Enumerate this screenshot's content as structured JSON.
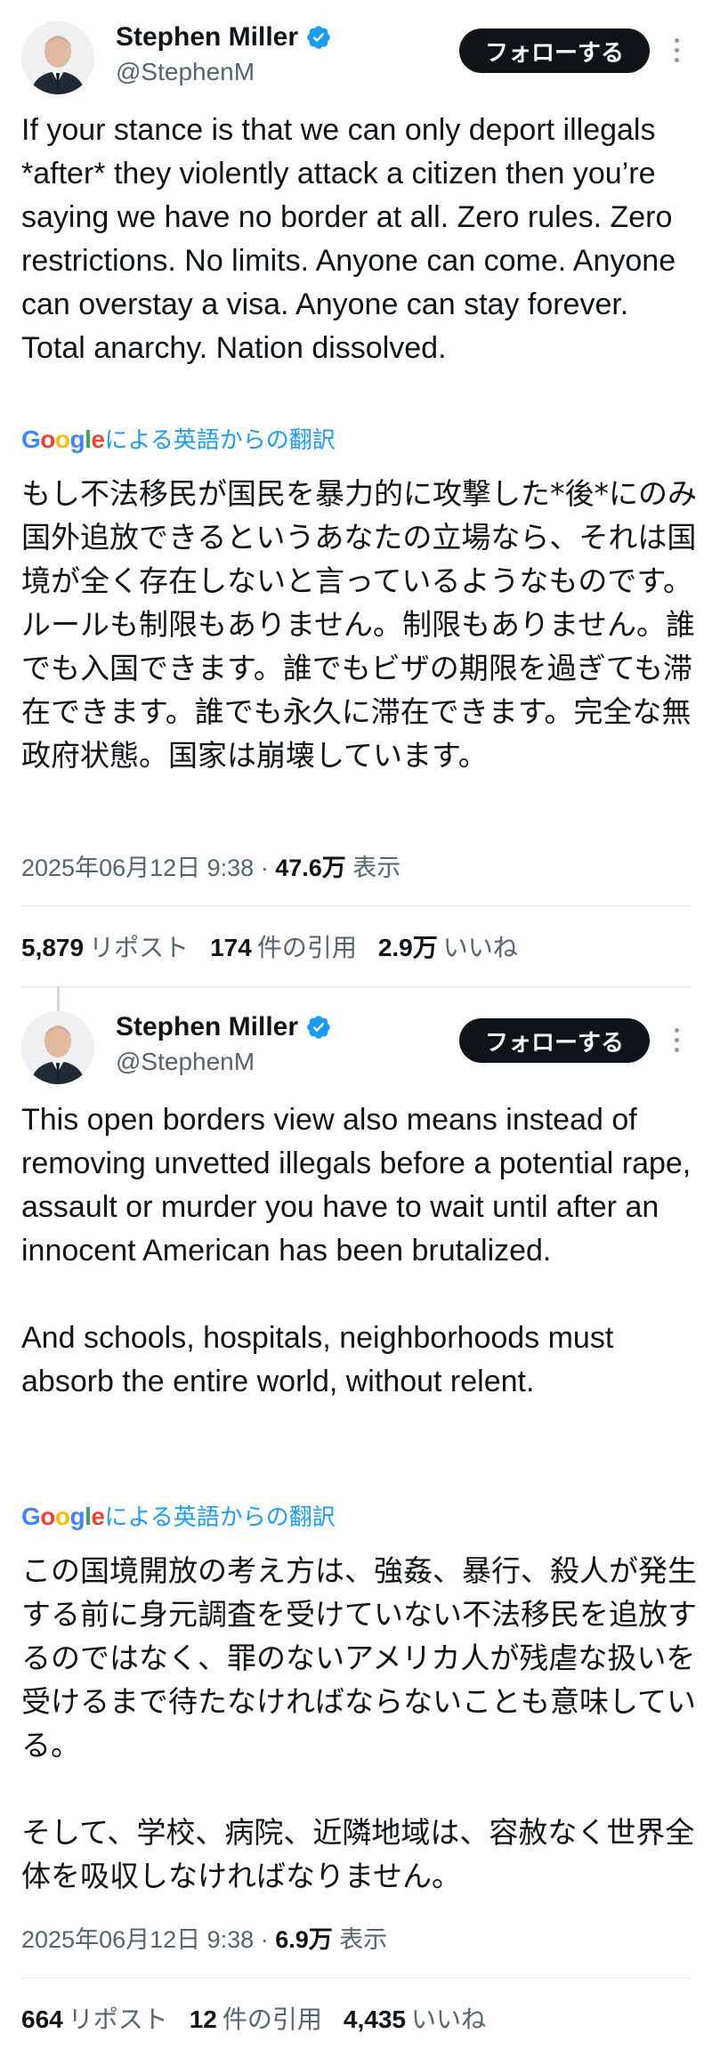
{
  "tweets": [
    {
      "author": "Stephen Miller",
      "handle": "@StephenM",
      "follow_label": "フォローする",
      "text": "If your stance is that we can only deport illegals *after* they violently attack a citizen then you’re saying we have no border at all. Zero rules. Zero restrictions. No limits. Anyone can come. Anyone can overstay a visa. Anyone can stay forever. Total anarchy. Nation dissolved.",
      "translate_label": "による英語からの翻訳",
      "translation": "もし不法移民が国民を暴力的に攻撃した*後*にのみ国外追放できるというあなたの立場なら、それは国境が全く存在しないと言っているようなものです。ルールも制限もありません。制限もありません。誰でも入国できます。誰でもビザの期限を過ぎても滞在できます。誰でも永久に滞在できます。完全な無政府状態。国家は崩壊しています。",
      "timestamp": "2025年06月12日 9:38",
      "views_value": "47.6万",
      "views_label": "表示",
      "reposts_value": "5,879",
      "reposts_label": "リポスト",
      "quotes_value": "174",
      "quotes_label": "件の引用",
      "likes_value": "2.9万",
      "likes_label": "いいね"
    },
    {
      "author": "Stephen Miller",
      "handle": "@StephenM",
      "follow_label": "フォローする",
      "text": "This open borders view also means instead of removing unvetted illegals before a potential rape, assault or murder you have to wait until after an innocent American has been brutalized.\n\nAnd schools, hospitals, neighborhoods must absorb the entire world, without relent.",
      "translate_label": "による英語からの翻訳",
      "translation": "この国境開放の考え方は、強姦、暴行、殺人が発生する前に身元調査を受けていない不法移民を追放するのではなく、罪のないアメリカ人が残虐な扱いを受けるまで待たなければならないことも意味している。\n\nそして、学校、病院、近隣地域は、容赦なく世界全体を吸収しなければなりません。",
      "timestamp": "2025年06月12日 9:38",
      "views_value": "6.9万",
      "views_label": "表示",
      "reposts_value": "664",
      "reposts_label": "リポスト",
      "quotes_value": "12",
      "quotes_label": "件の引用",
      "likes_value": "4,435",
      "likes_label": "いいね"
    }
  ],
  "google_logo": "Google",
  "colors": {
    "link": "#1d9bf0",
    "verified": "#1d9bf0",
    "muted": "#536471",
    "button": "#0f1419"
  }
}
